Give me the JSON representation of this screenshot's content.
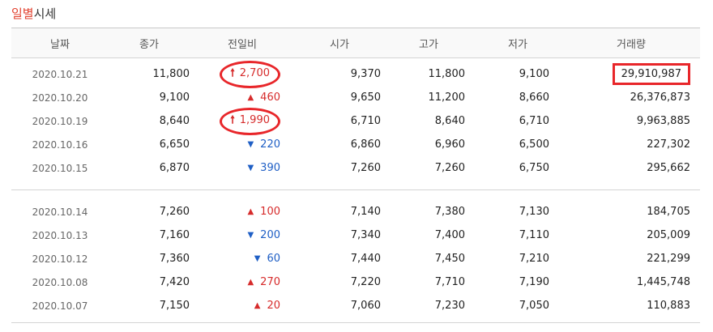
{
  "title": {
    "accent": "일별",
    "rest": "시세"
  },
  "columns": [
    "날짜",
    "종가",
    "전일비",
    "시가",
    "고가",
    "저가",
    "거래량"
  ],
  "colors": {
    "up": "#d62b2b",
    "down": "#1f5fc5",
    "highlight": "#e8262a",
    "accent": "#e2422f"
  },
  "group1": [
    {
      "date": "2020.10.21",
      "close": "11,800",
      "dir": "up",
      "arrow": "🠕",
      "change": "2,700",
      "open": "9,370",
      "high": "11,800",
      "low": "9,100",
      "volume": "29,910,987"
    },
    {
      "date": "2020.10.20",
      "close": "9,100",
      "dir": "up",
      "arrow": "▲",
      "change": "460",
      "open": "9,650",
      "high": "11,200",
      "low": "8,660",
      "volume": "26,376,873"
    },
    {
      "date": "2020.10.19",
      "close": "8,640",
      "dir": "up",
      "arrow": "🠕",
      "change": "1,990",
      "open": "6,710",
      "high": "8,640",
      "low": "6,710",
      "volume": "9,963,885"
    },
    {
      "date": "2020.10.16",
      "close": "6,650",
      "dir": "down",
      "arrow": "▼",
      "change": "220",
      "open": "6,860",
      "high": "6,960",
      "low": "6,500",
      "volume": "227,302"
    },
    {
      "date": "2020.10.15",
      "close": "6,870",
      "dir": "down",
      "arrow": "▼",
      "change": "390",
      "open": "7,260",
      "high": "7,260",
      "low": "6,750",
      "volume": "295,662"
    }
  ],
  "group2": [
    {
      "date": "2020.10.14",
      "close": "7,260",
      "dir": "up",
      "arrow": "▲",
      "change": "100",
      "open": "7,140",
      "high": "7,380",
      "low": "7,130",
      "volume": "184,705"
    },
    {
      "date": "2020.10.13",
      "close": "7,160",
      "dir": "down",
      "arrow": "▼",
      "change": "200",
      "open": "7,340",
      "high": "7,400",
      "low": "7,110",
      "volume": "205,009"
    },
    {
      "date": "2020.10.12",
      "close": "7,360",
      "dir": "down",
      "arrow": "▼",
      "change": "60",
      "open": "7,440",
      "high": "7,450",
      "low": "7,210",
      "volume": "221,299"
    },
    {
      "date": "2020.10.08",
      "close": "7,420",
      "dir": "up",
      "arrow": "▲",
      "change": "270",
      "open": "7,220",
      "high": "7,710",
      "low": "7,190",
      "volume": "1,445,748"
    },
    {
      "date": "2020.10.07",
      "close": "7,150",
      "dir": "up",
      "arrow": "▲",
      "change": "20",
      "open": "7,060",
      "high": "7,230",
      "low": "7,050",
      "volume": "110,883"
    }
  ]
}
